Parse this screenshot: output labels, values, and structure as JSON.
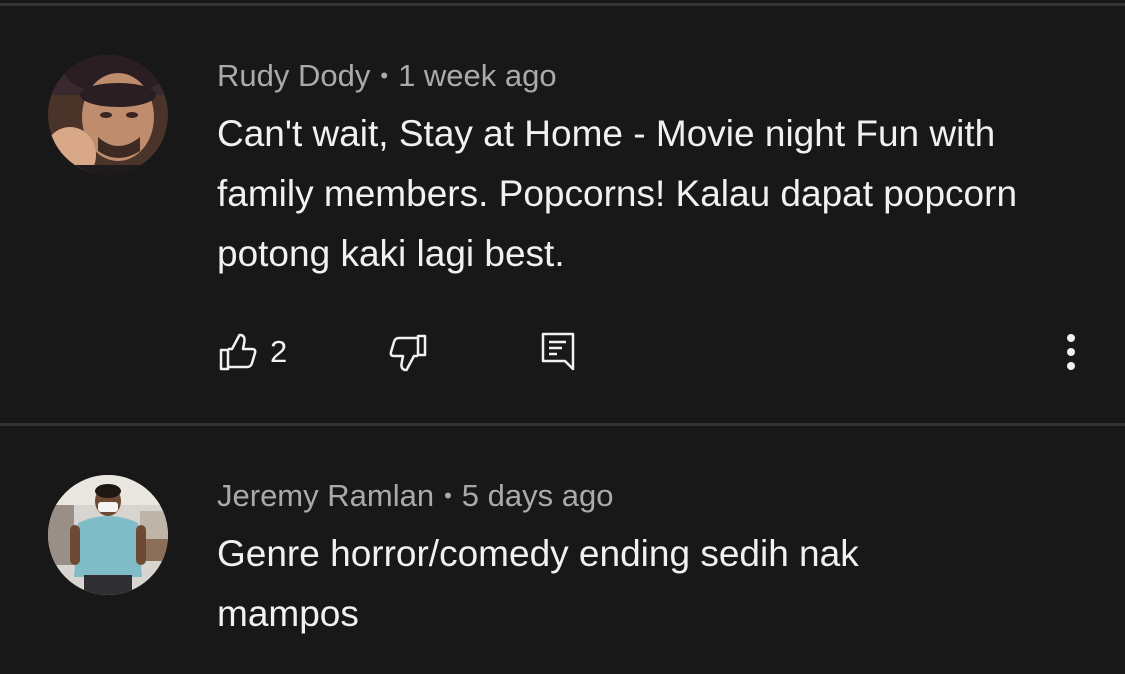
{
  "comments": [
    {
      "author": "Rudy Dody",
      "separator": "•",
      "time": "1 week ago",
      "text": "Can't wait, Stay at Home - Movie night Fun with family members. Popcorns! Kalau dapat popcorn potong kaki lagi best.",
      "likes": "2",
      "avatar_icon": "user-avatar"
    },
    {
      "author": "Jeremy Ramlan",
      "separator": "•",
      "time": "5 days ago",
      "text": "Genre horror/comedy ending sedih nak mampos",
      "avatar_icon": "user-avatar"
    }
  ],
  "icons": {
    "like": "thumbs-up-icon",
    "dislike": "thumbs-down-icon",
    "reply": "reply-icon",
    "more": "more-vertical-icon"
  },
  "colors": {
    "background": "#181818",
    "divider": "#333333",
    "text_primary": "#f1f1f1",
    "text_secondary": "#aaaaaa"
  }
}
